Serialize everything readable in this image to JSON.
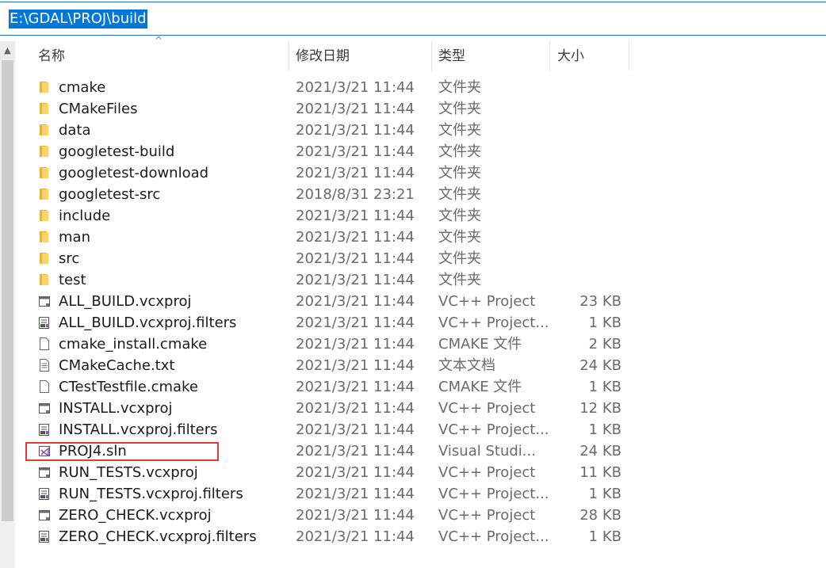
{
  "address_bar": {
    "path": "E:\\GDAL\\PROJ\\build"
  },
  "columns": {
    "name": "名称",
    "date": "修改日期",
    "type": "类型",
    "size": "大小"
  },
  "files": [
    {
      "name": "cmake",
      "date": "2021/3/21 11:44",
      "type": "文件夹",
      "size": "",
      "icon": "folder-icon"
    },
    {
      "name": "CMakeFiles",
      "date": "2021/3/21 11:44",
      "type": "文件夹",
      "size": "",
      "icon": "folder-icon"
    },
    {
      "name": "data",
      "date": "2021/3/21 11:44",
      "type": "文件夹",
      "size": "",
      "icon": "folder-icon"
    },
    {
      "name": "googletest-build",
      "date": "2021/3/21 11:44",
      "type": "文件夹",
      "size": "",
      "icon": "folder-icon"
    },
    {
      "name": "googletest-download",
      "date": "2021/3/21 11:44",
      "type": "文件夹",
      "size": "",
      "icon": "folder-icon"
    },
    {
      "name": "googletest-src",
      "date": "2018/8/31 23:21",
      "type": "文件夹",
      "size": "",
      "icon": "folder-icon"
    },
    {
      "name": "include",
      "date": "2021/3/21 11:44",
      "type": "文件夹",
      "size": "",
      "icon": "folder-icon"
    },
    {
      "name": "man",
      "date": "2021/3/21 11:44",
      "type": "文件夹",
      "size": "",
      "icon": "folder-icon"
    },
    {
      "name": "src",
      "date": "2021/3/21 11:44",
      "type": "文件夹",
      "size": "",
      "icon": "folder-icon"
    },
    {
      "name": "test",
      "date": "2021/3/21 11:44",
      "type": "文件夹",
      "size": "",
      "icon": "folder-icon"
    },
    {
      "name": "ALL_BUILD.vcxproj",
      "date": "2021/3/21 11:44",
      "type": "VC++ Project",
      "size": "23 KB",
      "icon": "vcxproj-icon"
    },
    {
      "name": "ALL_BUILD.vcxproj.filters",
      "date": "2021/3/21 11:44",
      "type": "VC++ Project...",
      "size": "1 KB",
      "icon": "filters-icon"
    },
    {
      "name": "cmake_install.cmake",
      "date": "2021/3/21 11:44",
      "type": "CMAKE 文件",
      "size": "2 KB",
      "icon": "blank-file-icon"
    },
    {
      "name": "CMakeCache.txt",
      "date": "2021/3/21 11:44",
      "type": "文本文档",
      "size": "24 KB",
      "icon": "text-file-icon"
    },
    {
      "name": "CTestTestfile.cmake",
      "date": "2021/3/21 11:44",
      "type": "CMAKE 文件",
      "size": "1 KB",
      "icon": "blank-file-icon"
    },
    {
      "name": "INSTALL.vcxproj",
      "date": "2021/3/21 11:44",
      "type": "VC++ Project",
      "size": "12 KB",
      "icon": "vcxproj-icon"
    },
    {
      "name": "INSTALL.vcxproj.filters",
      "date": "2021/3/21 11:44",
      "type": "VC++ Project...",
      "size": "1 KB",
      "icon": "filters-icon"
    },
    {
      "name": "PROJ4.sln",
      "date": "2021/3/21 11:44",
      "type": "Visual Studi...",
      "size": "24 KB",
      "icon": "visual-studio-icon"
    },
    {
      "name": "RUN_TESTS.vcxproj",
      "date": "2021/3/21 11:44",
      "type": "VC++ Project",
      "size": "11 KB",
      "icon": "vcxproj-icon"
    },
    {
      "name": "RUN_TESTS.vcxproj.filters",
      "date": "2021/3/21 11:44",
      "type": "VC++ Project...",
      "size": "1 KB",
      "icon": "filters-icon"
    },
    {
      "name": "ZERO_CHECK.vcxproj",
      "date": "2021/3/21 11:44",
      "type": "VC++ Project",
      "size": "28 KB",
      "icon": "vcxproj-icon"
    },
    {
      "name": "ZERO_CHECK.vcxproj.filters",
      "date": "2021/3/21 11:44",
      "type": "VC++ Project...",
      "size": "1 KB",
      "icon": "filters-icon"
    }
  ],
  "highlight_color": "#e53935",
  "selection_color": "#0078d7"
}
